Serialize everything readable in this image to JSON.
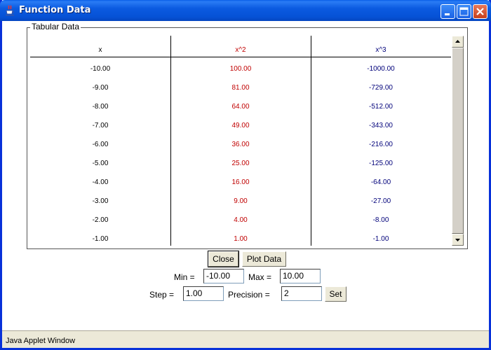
{
  "window": {
    "title": "Function Data",
    "accent": "#0a5fe8"
  },
  "panel": {
    "label": "Tabular Data"
  },
  "table": {
    "headers": [
      "x",
      "x^2",
      "x^3"
    ],
    "rows": [
      [
        "-10.00",
        "100.00",
        "-1000.00"
      ],
      [
        "-9.00",
        "81.00",
        "-729.00"
      ],
      [
        "-8.00",
        "64.00",
        "-512.00"
      ],
      [
        "-7.00",
        "49.00",
        "-343.00"
      ],
      [
        "-6.00",
        "36.00",
        "-216.00"
      ],
      [
        "-5.00",
        "25.00",
        "-125.00"
      ],
      [
        "-4.00",
        "16.00",
        "-64.00"
      ],
      [
        "-3.00",
        "9.00",
        "-27.00"
      ],
      [
        "-2.00",
        "4.00",
        "-8.00"
      ],
      [
        "-1.00",
        "1.00",
        "-1.00"
      ]
    ],
    "colors": {
      "x": "#000000",
      "x2": "#c00000",
      "x3": "#00007a"
    }
  },
  "buttons": {
    "close": "Close",
    "plot": "Plot Data",
    "set": "Set"
  },
  "fields": {
    "min_label": "Min =",
    "min_value": "-10.00",
    "max_label": "Max =",
    "max_value": "10.00",
    "step_label": "Step =",
    "step_value": "1.00",
    "precision_label": "Precision =",
    "precision_value": "2"
  },
  "status": {
    "text": "Java Applet Window"
  },
  "icons": {
    "app": "java-cup-icon",
    "minimize": "minimize-icon",
    "maximize": "maximize-icon",
    "close": "close-icon",
    "scroll_up": "arrow-up-icon",
    "scroll_down": "arrow-down-icon"
  }
}
